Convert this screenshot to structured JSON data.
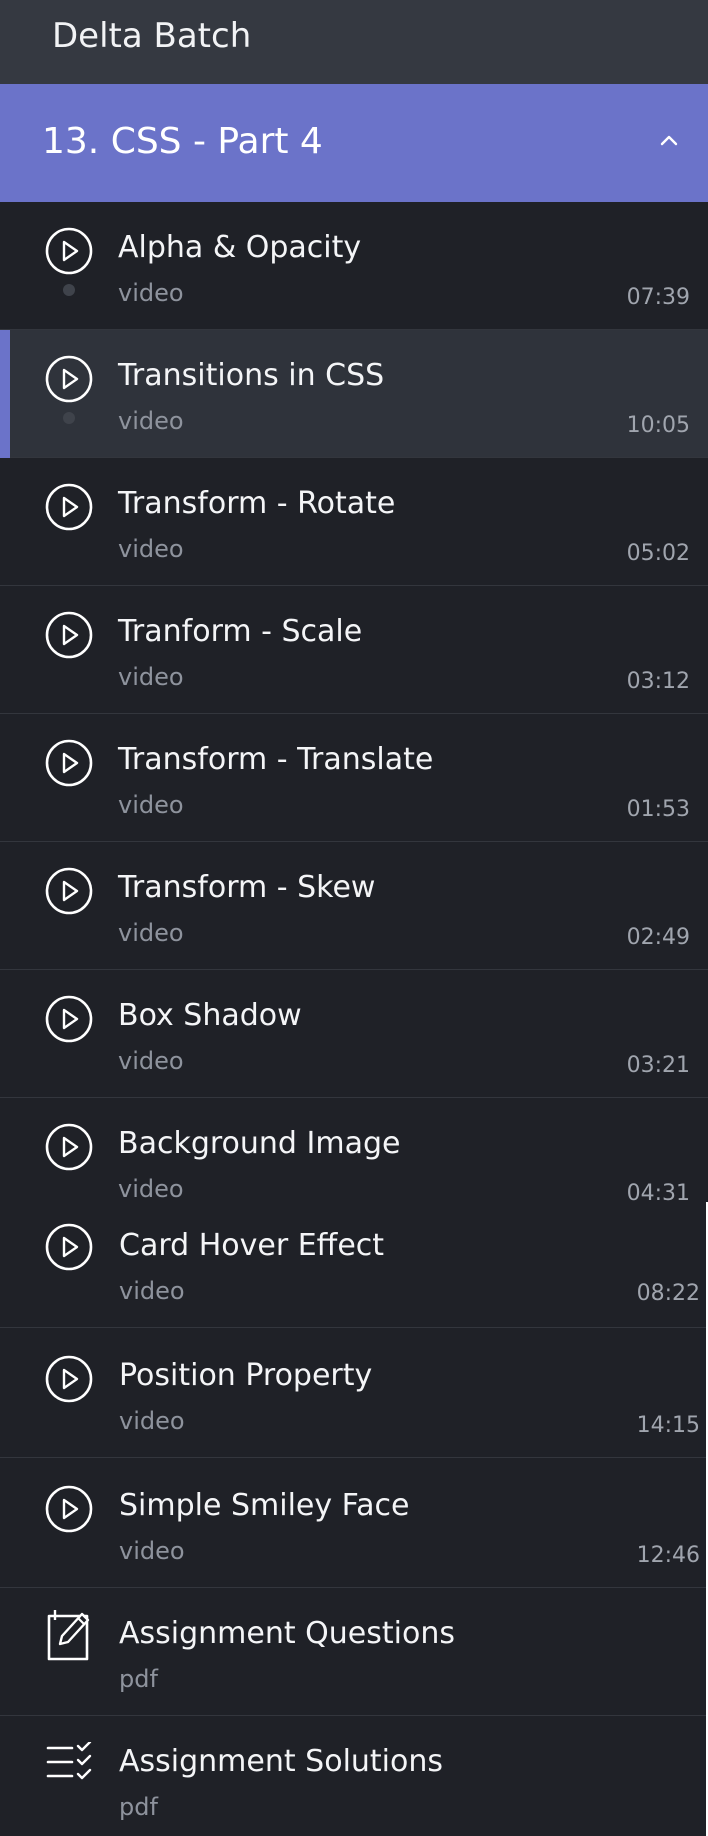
{
  "header": {
    "title": "Delta Batch"
  },
  "section": {
    "title": "13. CSS - Part 4",
    "expanded": true,
    "chevron_icon": "chevron-up-icon"
  },
  "colors": {
    "accent": "#6b73c9",
    "background": "#1f2127",
    "topbar": "#353941",
    "active_item": "#2f333b"
  },
  "items": [
    {
      "title": "Alpha & Opacity",
      "type": "video",
      "duration": "07:39",
      "icon": "play-circle-icon",
      "active": false
    },
    {
      "title": "Transitions in CSS",
      "type": "video",
      "duration": "10:05",
      "icon": "play-circle-icon",
      "active": true
    },
    {
      "title": "Transform - Rotate",
      "type": "video",
      "duration": "05:02",
      "icon": "play-circle-icon",
      "active": false
    },
    {
      "title": "Tranform - Scale",
      "type": "video",
      "duration": "03:12",
      "icon": "play-circle-icon",
      "active": false
    },
    {
      "title": "Transform - Translate",
      "type": "video",
      "duration": "01:53",
      "icon": "play-circle-icon",
      "active": false
    },
    {
      "title": "Transform - Skew",
      "type": "video",
      "duration": "02:49",
      "icon": "play-circle-icon",
      "active": false
    },
    {
      "title": "Box Shadow",
      "type": "video",
      "duration": "03:21",
      "icon": "play-circle-icon",
      "active": false
    },
    {
      "title": "Background Image",
      "type": "video",
      "duration": "04:31",
      "icon": "play-circle-icon",
      "active": false
    },
    {
      "title": "Card Hover Effect",
      "type": "video",
      "duration": "08:22",
      "icon": "play-circle-icon",
      "active": false
    },
    {
      "title": "Position Property",
      "type": "video",
      "duration": "14:15",
      "icon": "play-circle-icon",
      "active": false
    },
    {
      "title": "Simple Smiley Face",
      "type": "video",
      "duration": "12:46",
      "icon": "play-circle-icon",
      "active": false
    },
    {
      "title": "Assignment Questions",
      "type": "pdf",
      "duration": "",
      "icon": "pencil-note-icon",
      "active": false
    },
    {
      "title": "Assignment Solutions",
      "type": "pdf",
      "duration": "",
      "icon": "checklist-icon",
      "active": false
    }
  ]
}
